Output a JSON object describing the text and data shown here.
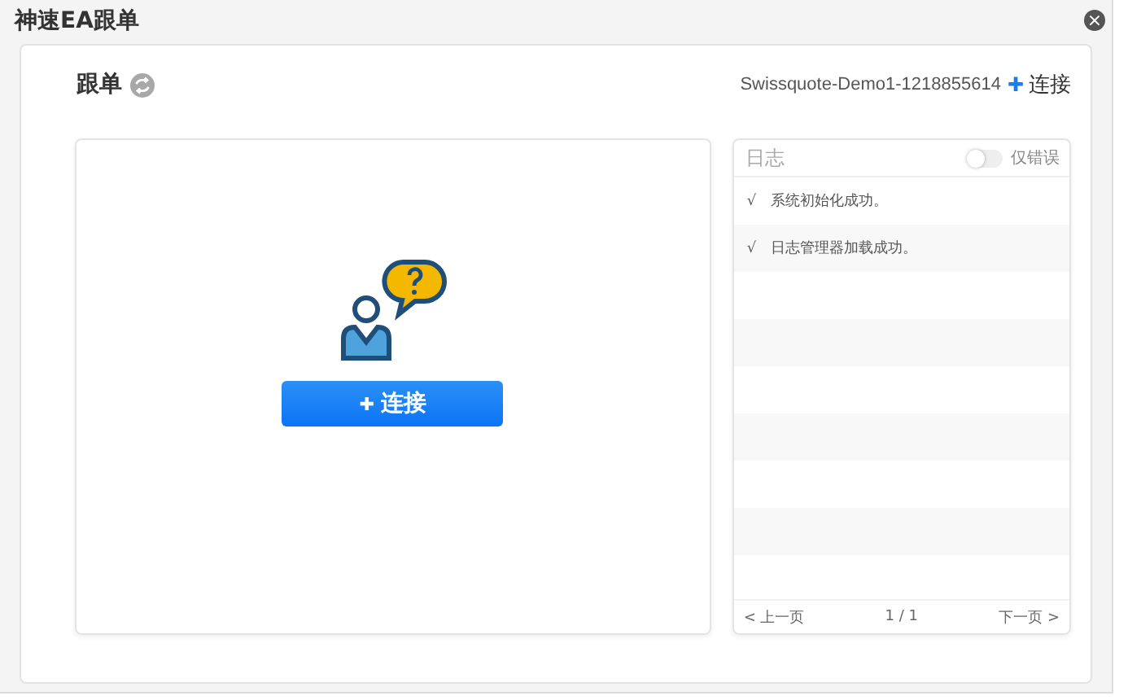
{
  "window": {
    "title": "神速EA跟单",
    "close_label": "×"
  },
  "header": {
    "title": "跟单",
    "account": "Swissquote-Demo1-1218855614",
    "connect_icon": "✚",
    "connect_label": "连接"
  },
  "main": {
    "button_icon": "✚",
    "button_label": "连接"
  },
  "log": {
    "title": "日志",
    "errors_only": {
      "label": "仅错误",
      "on": false
    },
    "entries": [
      {
        "mark": "√",
        "text": "系统初始化成功。"
      },
      {
        "mark": "√",
        "text": "日志管理器加载成功。"
      }
    ],
    "pager": {
      "prev": "< 上一页",
      "page": "1 / 1",
      "next": "下一页 >"
    }
  }
}
